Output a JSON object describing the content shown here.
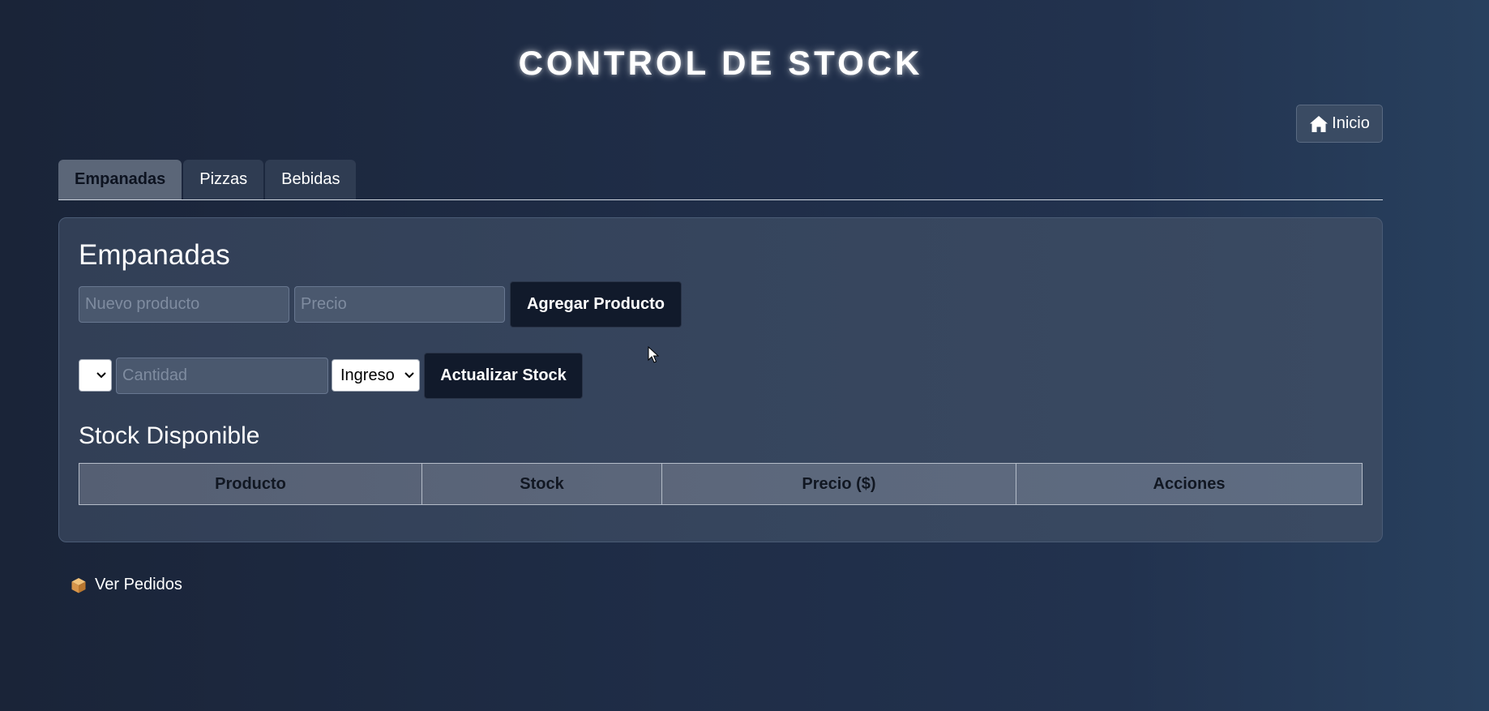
{
  "header": {
    "title": "CONTROL DE STOCK",
    "home_button": {
      "label": "Inicio",
      "icon": "home-icon"
    }
  },
  "tabs": [
    {
      "label": "Empanadas",
      "active": true
    },
    {
      "label": "Pizzas",
      "active": false
    },
    {
      "label": "Bebidas",
      "active": false
    }
  ],
  "panel": {
    "title": "Empanadas",
    "add_form": {
      "product_placeholder": "Nuevo producto",
      "price_placeholder": "Precio",
      "product_value": "",
      "price_value": "",
      "submit_label": "Agregar Producto"
    },
    "update_form": {
      "product_select_value": "",
      "quantity_placeholder": "Cantidad",
      "quantity_value": "",
      "type_select_value": "Ingreso",
      "submit_label": "Actualizar Stock"
    },
    "stock_section_title": "Stock Disponible",
    "table": {
      "headers": [
        "Producto",
        "Stock",
        "Precio ($)",
        "Acciones"
      ],
      "rows": []
    }
  },
  "footer": {
    "orders_link": {
      "label": "Ver Pedidos",
      "icon": "package-icon"
    }
  },
  "colors": {
    "background": "#1f2d47",
    "panel": "#36455d",
    "dark_button": "#111a2b",
    "active_tab": "#5b6678",
    "table_header": "#5c677b"
  }
}
